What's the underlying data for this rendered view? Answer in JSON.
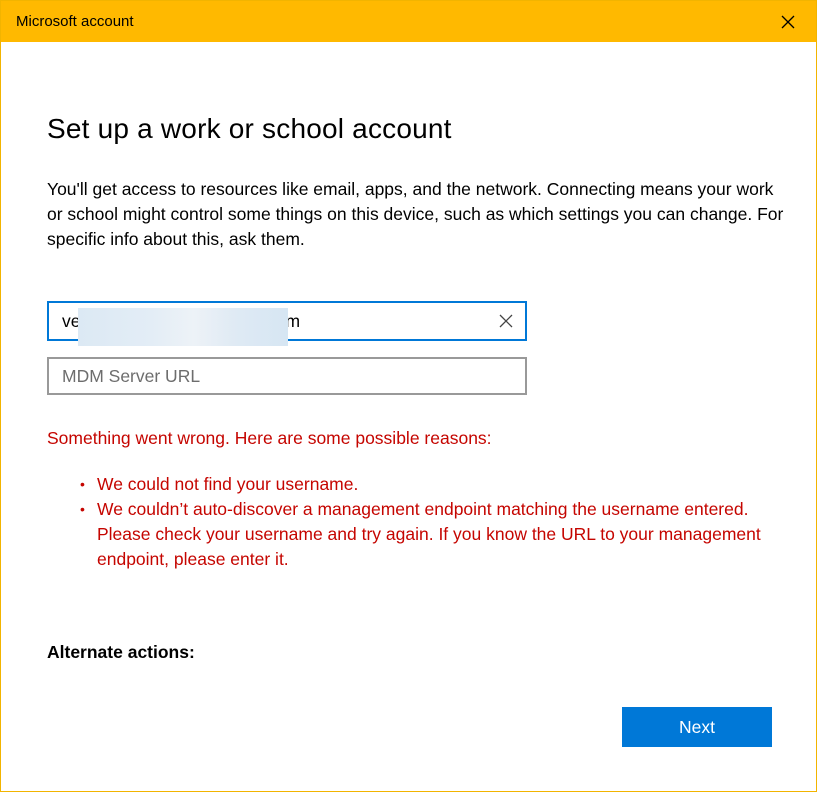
{
  "window": {
    "title": "Microsoft account"
  },
  "page": {
    "heading": "Set up a work or school account",
    "description": "You'll get access to resources like email, apps, and the network. Connecting means your work or school might control some things on this device, such as which settings you can change. For specific info about this, ask them."
  },
  "email_field": {
    "value_prefix": "ve",
    "value_suffix": "m",
    "redacted": true
  },
  "mdm_field": {
    "value": "",
    "placeholder": "MDM Server URL"
  },
  "error": {
    "heading": "Something went wrong. Here are some possible reasons:",
    "reasons": [
      "We could not find your username.",
      "We couldn’t auto-discover a management endpoint matching the username entered. Please check your username and try again. If you know the URL to your management endpoint, please enter it."
    ]
  },
  "alternate_actions_label": "Alternate actions:",
  "buttons": {
    "next": "Next"
  },
  "colors": {
    "titlebar": "#ffb900",
    "accent": "#0078d7",
    "error": "#c50500",
    "input_border": "#999999"
  },
  "icons": {
    "close": "close-icon",
    "clear": "clear-input-icon"
  }
}
